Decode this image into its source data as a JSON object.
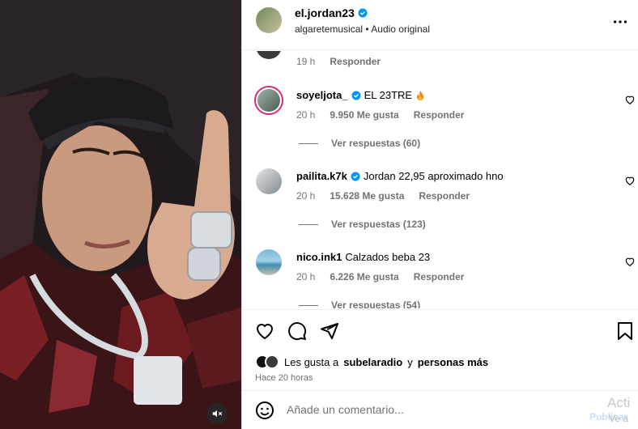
{
  "post": {
    "username": "el.jordan23",
    "audio_user": "algaretemusical",
    "audio_separator": "•",
    "audio_label": "Audio original"
  },
  "top_partial": {
    "time": "19 h",
    "reply": "Responder"
  },
  "comments": [
    {
      "username": "soyeljota_",
      "verified": true,
      "text": "EL 23TRE",
      "emoji": "fire",
      "time": "20 h",
      "likes": "9.950 Me gusta",
      "reply": "Responder",
      "view_replies": "Ver respuestas (60)"
    },
    {
      "username": "pailita.k7k",
      "verified": true,
      "text": "Jordan 22,95 aproximado hno",
      "time": "20 h",
      "likes": "15.628 Me gusta",
      "reply": "Responder",
      "view_replies": "Ver respuestas (123)"
    },
    {
      "username": "nico.ink1",
      "verified": false,
      "text": "Calzados beba 23",
      "time": "20 h",
      "likes": "6.226 Me gusta",
      "reply": "Responder",
      "view_replies": "Ver respuestas (54)"
    }
  ],
  "likes_line": {
    "prefix": "Les gusta a",
    "user": "subelaradio",
    "middle": "y",
    "suffix": "personas más"
  },
  "posted_time": "Hace 20 horas",
  "comment_input": {
    "placeholder": "Añade un comentario..."
  },
  "watermark": {
    "line1": "Acti",
    "line2": "Ve a",
    "line3": "Publicar"
  },
  "colors": {
    "verified": "#0095f6",
    "muted": "#737373",
    "story_ring": "#d62976"
  }
}
